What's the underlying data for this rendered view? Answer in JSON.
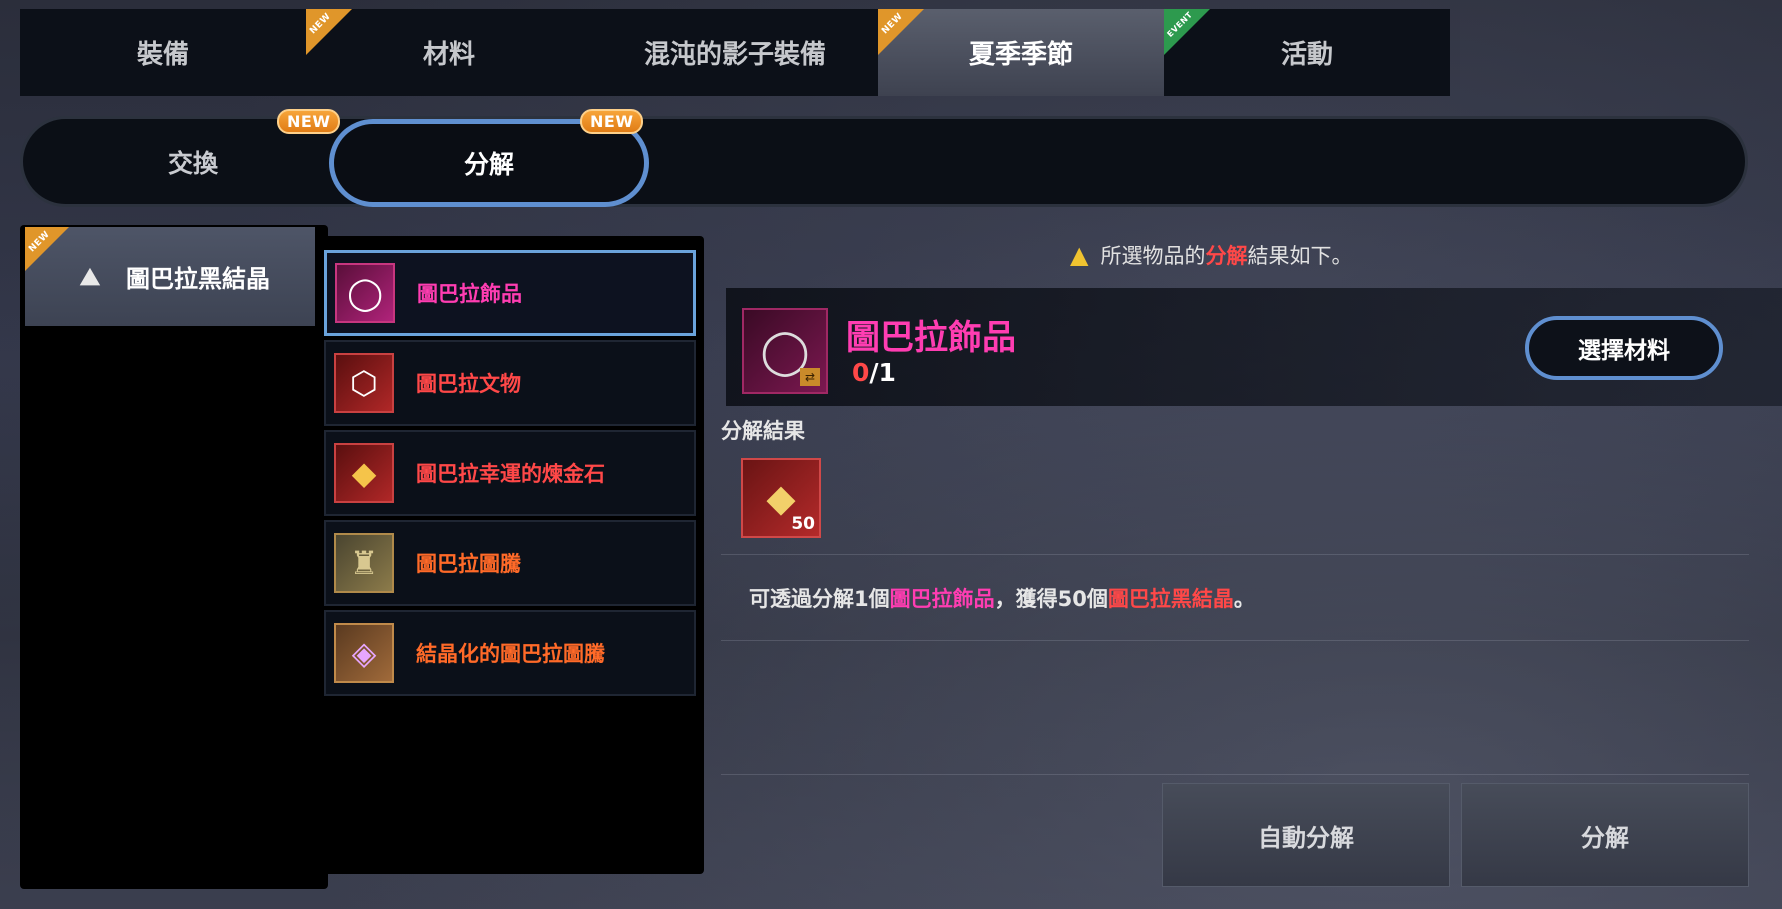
{
  "top_tabs": [
    {
      "label": "裝備",
      "badge": ""
    },
    {
      "label": "材料",
      "badge": "NEW"
    },
    {
      "label": "混沌的影子裝備",
      "badge": ""
    },
    {
      "label": "夏季季節",
      "badge": "NEW"
    },
    {
      "label": "活動",
      "badge": "EVENT"
    }
  ],
  "sub_tabs": [
    {
      "label": "交換",
      "badge": "NEW"
    },
    {
      "label": "分解",
      "badge": "NEW"
    }
  ],
  "category": {
    "label": "圖巴拉黑結晶",
    "badge": "NEW",
    "icon": "crystal-icon"
  },
  "items": [
    {
      "name": "圖巴拉飾品",
      "icon": "ring-icon",
      "color": "#ff3db2"
    },
    {
      "name": "圖巴拉文物",
      "icon": "relic-icon",
      "color": "#ff4848"
    },
    {
      "name": "圖巴拉幸運的煉金石",
      "icon": "alchemy-stone-icon",
      "color": "#ff4848"
    },
    {
      "name": "圖巴拉圖騰",
      "icon": "totem-icon",
      "color": "#ff6a28"
    },
    {
      "name": "結晶化的圖巴拉圖騰",
      "icon": "crystal-totem-icon",
      "color": "#ff6a28"
    }
  ],
  "notice": {
    "prefix": "所選物品的",
    "highlight": "分解",
    "suffix": "結果如下。"
  },
  "selected": {
    "name": "圖巴拉飾品",
    "have": "0",
    "need": "/1"
  },
  "choose_button": "選擇材料",
  "result_label": "分解結果",
  "result_qty": "50",
  "description": {
    "p1": "可透過分解1個",
    "item": "圖巴拉飾品",
    "p2": "，獲得50個",
    "reward": "圖巴拉黑結晶",
    "p3": "。"
  },
  "buttons": {
    "auto": "自動分解",
    "decompose": "分解"
  }
}
